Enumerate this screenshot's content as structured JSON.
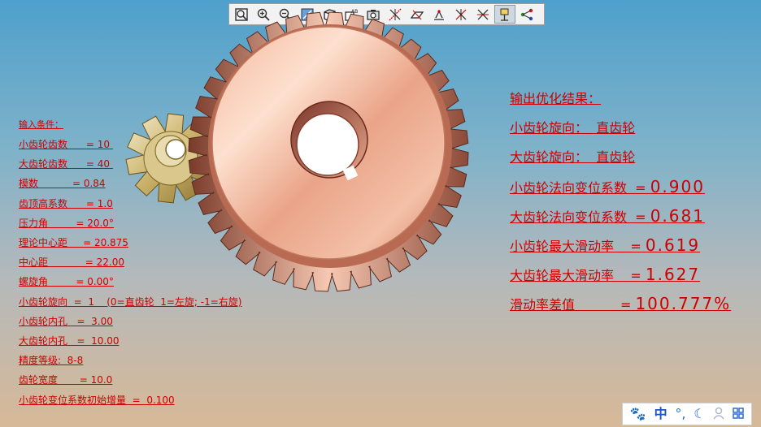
{
  "toolbar": {
    "buttons": [
      {
        "icon": "zoom-fit-icon"
      },
      {
        "icon": "zoom-in-icon"
      },
      {
        "icon": "zoom-out-icon"
      },
      {
        "icon": "sketch-view-icon"
      },
      {
        "icon": "box-view-icon"
      },
      {
        "icon": "annotation-display-icon"
      },
      {
        "icon": "camera-icon"
      },
      {
        "icon": "axis-display-icon"
      },
      {
        "icon": "plane-display-icon"
      },
      {
        "icon": "point-display-icon"
      },
      {
        "icon": "coordinate-system-icon"
      },
      {
        "icon": "datum-display-icon"
      },
      {
        "icon": "annotation-pin-icon",
        "active": true
      },
      {
        "icon": "network-icon"
      }
    ]
  },
  "input_panel": {
    "title": "输入条件：",
    "rows": [
      "小齿轮齿数      = 10 ",
      "大齿轮齿数      = 40 ",
      "模数           = 0.84",
      "齿顶高系数      = 1.0",
      "压力角         = 20.0°",
      "理论中心距     = 20.875",
      "中心距            = 22.00",
      "螺旋角         = 0.00°",
      "小齿轮旋向  =  1    (0=直齿轮  1=左旋; -1=右旋)",
      "小齿轮内孔   =  3.00",
      "大齿轮内孔   =  10.00",
      "精度等级:  8-8",
      "齿轮宽度       = 10.0",
      "小齿轮变位系数初始增量  =  0.100"
    ]
  },
  "output_panel": {
    "title": "输出优化结果：",
    "pinion_helix": {
      "label": "小齿轮旋向：",
      "value": "直齿轮"
    },
    "gear_helix": {
      "label": "大齿轮旋向：",
      "value": "直齿轮"
    },
    "pinion_shift": {
      "label": "小齿轮法向变位系数  =",
      "value": "0.900"
    },
    "gear_shift": {
      "label": "大齿轮法向变位系数  =",
      "value": "0.681"
    },
    "pinion_slip": {
      "label": "小齿轮最大滑动率    =",
      "value": "0.619"
    },
    "gear_slip": {
      "label": "大齿轮最大滑动率    =",
      "value": "1.627"
    },
    "slip_diff": {
      "label": "滑动率差值           =",
      "value": "100.777%"
    }
  },
  "ime_bar": {
    "paw_icon": "paw-icon",
    "mode": "中",
    "punct": "°,",
    "moon_icon": "moon-icon",
    "user_icon": "user-icon",
    "grid_icon": "grid-icon"
  },
  "model": {
    "pinion_teeth": 10,
    "gear_teeth": 40,
    "gear_color": "#e9a98e",
    "pinion_color": "#d8c890"
  }
}
